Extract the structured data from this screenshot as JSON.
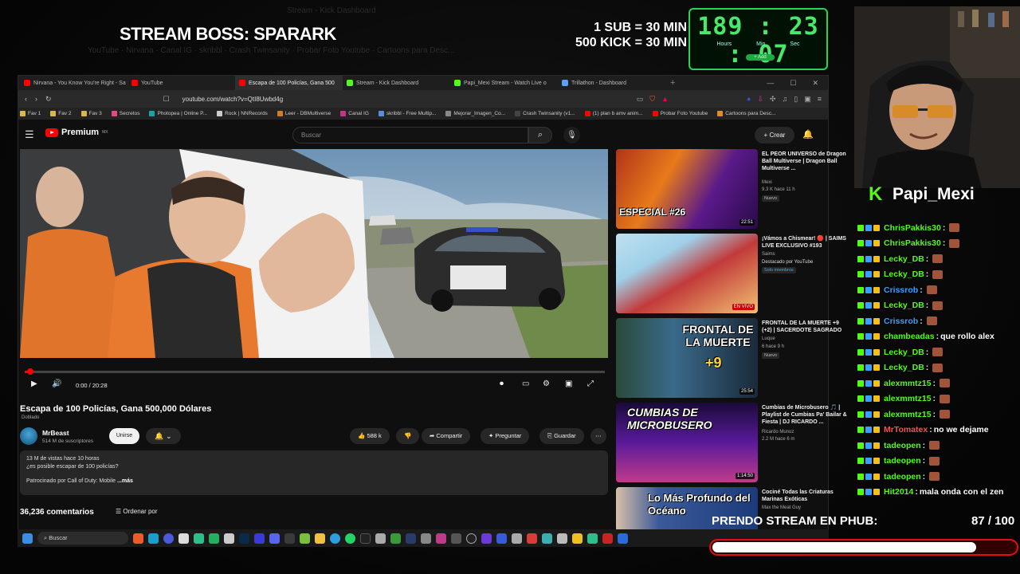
{
  "overlay": {
    "boss_title": "STREAM BOSS: SPARARK",
    "rule_sub": "1 SUB = 30 MIN",
    "rule_kick": "500 KICK = 30 MIN",
    "timer": {
      "hours": "189",
      "minutes": "23",
      "seconds": "07",
      "hours_label": "Hours",
      "minutes_label": "Min",
      "seconds_label": "Sec",
      "button": "+ Add"
    },
    "streamer": "Papi_Mexi",
    "goal_label": "PRENDO STREAM EN PHUB:",
    "goal_count": "87 / 100",
    "goal_progress": 0.87,
    "accent_green": "#53fc18",
    "goal_red": "#dd1111"
  },
  "browser": {
    "tabs": [
      {
        "label": "Nirvana - You Know You're Right - Sa",
        "color": "#ff0000"
      },
      {
        "label": "YouTube",
        "color": "#ff0000"
      },
      {
        "label": "Escapa de 100 Policías, Gana 500",
        "color": "#ff0000",
        "active": true
      },
      {
        "label": "Stream - Kick Dashboard",
        "color": "#53fc18"
      },
      {
        "label": "Papi_Mexi Stream - Watch Live o",
        "color": "#53fc18"
      },
      {
        "label": "Trillathon - Dashboard",
        "color": "#5aa0ff"
      }
    ],
    "url": "youtube.com/watch?v=QtI8Uwbd4g",
    "bookmarks": [
      {
        "label": "Fav 1",
        "color": "#d9b84a"
      },
      {
        "label": "Fav 2",
        "color": "#d9b84a"
      },
      {
        "label": "Fav 3",
        "color": "#d9b84a"
      },
      {
        "label": "Secretos",
        "color": "#e04a8a"
      },
      {
        "label": "Photopea | Online P...",
        "color": "#19a3a3"
      },
      {
        "label": "Rock | NNRecords",
        "color": "#cccccc"
      },
      {
        "label": "Leer - DBMultiverse",
        "color": "#d07a2a"
      },
      {
        "label": "Canal IG",
        "color": "#c13584"
      },
      {
        "label": "skribbl - Free Multip...",
        "color": "#5a8ad8"
      },
      {
        "label": "Mejorar_Imagen_Co...",
        "color": "#888888"
      },
      {
        "label": "Crash Twinsanity (v1...",
        "color": "#444444"
      },
      {
        "label": "(1) plan b amv anim...",
        "color": "#ff0000"
      },
      {
        "label": "Probar Foto Youtube",
        "color": "#ff0000"
      },
      {
        "label": "Cartoons para Desc...",
        "color": "#e08a2a"
      }
    ]
  },
  "youtube": {
    "logo": "Premium",
    "logo_region": "MX",
    "search_placeholder": "Buscar",
    "create_label": "+ Crear",
    "time": "0:00 / 20:28",
    "progress": 0.01,
    "video_title": "Escapa de 100 Policías, Gana 500,000 Dólares",
    "dubbed": "Doblado",
    "channel": "MrBeast",
    "subscribers": "514 M de suscriptores",
    "join": "Unirse",
    "likes": "588 k",
    "share": "Compartir",
    "ask": "Preguntar",
    "save": "Guardar",
    "views_line": "13 M de vistas  hace 10 horas",
    "desc_line": "¿es posible escapar de 100 policías?",
    "sponsor_line": "Patrocinado por Call of Duty: Mobile",
    "more": "...más",
    "comments": "36,236 comentarios",
    "sort": "Ordenar por",
    "recommendations": [
      {
        "title": "EL PEOR UNIVERSO de Dragon Ball Multiverse | Dragon Ball Multiverse ...",
        "channel": "Mexi",
        "meta": "9.3 K  hace 11 h",
        "badge": "Nuevo",
        "duration": "22:51",
        "thumb_text": "ESPECIAL #26"
      },
      {
        "title": "¡Vámos a Chismear! 🔴 | SAIMS LIVE EXCLUSIVO #193",
        "channel": "Saims",
        "meta": "Destacado por YouTube",
        "badge": "Solo miembros",
        "duration": "EN VIVO",
        "thumb_text": ""
      },
      {
        "title": "FRONTAL DE LA MUERTE +9 (+2) | SACERDOTE SAGRADO",
        "channel": "Luque",
        "meta": "6  hace 9 h",
        "badge": "Nuevo",
        "duration": "25:54",
        "thumb_text": "FRONTAL DE LA MUERTE"
      },
      {
        "title": "Cumbias de Microbusero 🎵 | Playlist de Cumbias Pa' Bailar & Fiesta | DJ RICARDO ...",
        "channel": "Ricardo Munoz",
        "meta": "2.2 M  hace 6 m",
        "badge": "",
        "duration": "1:14:50",
        "thumb_text": "CUMBIAS DE MICROBUSERO"
      },
      {
        "title": "Cociné Todas las Criaturas Marinas Exóticas",
        "channel": "Max the Meat Guy",
        "meta": "",
        "badge": "",
        "duration": "",
        "thumb_text": "Lo Más Profundo del Océano"
      }
    ]
  },
  "chat": [
    {
      "user": "ChrisPakkis30",
      "color": "#53fc18",
      "msg": ""
    },
    {
      "user": "ChrisPakkis30",
      "color": "#53fc18",
      "msg": ""
    },
    {
      "user": "Lecky_DB",
      "color": "#53fc18",
      "msg": ""
    },
    {
      "user": "Lecky_DB",
      "color": "#53fc18",
      "msg": ""
    },
    {
      "user": "Crissrob",
      "color": "#3aa0ff",
      "msg": ""
    },
    {
      "user": "Lecky_DB",
      "color": "#53fc18",
      "msg": ""
    },
    {
      "user": "Crissrob",
      "color": "#3aa0ff",
      "msg": ""
    },
    {
      "user": "chambeadas",
      "color": "#53fc18",
      "msg": "que rollo alex"
    },
    {
      "user": "Lecky_DB",
      "color": "#53fc18",
      "msg": ""
    },
    {
      "user": "Lecky_DB",
      "color": "#53fc18",
      "msg": ""
    },
    {
      "user": "alexmmtz15",
      "color": "#53fc18",
      "msg": ""
    },
    {
      "user": "alexmmtz15",
      "color": "#53fc18",
      "msg": ""
    },
    {
      "user": "alexmmtz15",
      "color": "#53fc18",
      "msg": ""
    },
    {
      "user": "MrTomatex",
      "color": "#ff5050",
      "msg": "no we dejame"
    },
    {
      "user": "tadeopen",
      "color": "#53fc18",
      "msg": ""
    },
    {
      "user": "tadeopen",
      "color": "#53fc18",
      "msg": ""
    },
    {
      "user": "tadeopen",
      "color": "#53fc18",
      "msg": ""
    },
    {
      "user": "Hit2014",
      "color": "#53fc18",
      "msg": "mala onda con el zen"
    }
  ],
  "taskbar": {
    "search": "Buscar"
  }
}
